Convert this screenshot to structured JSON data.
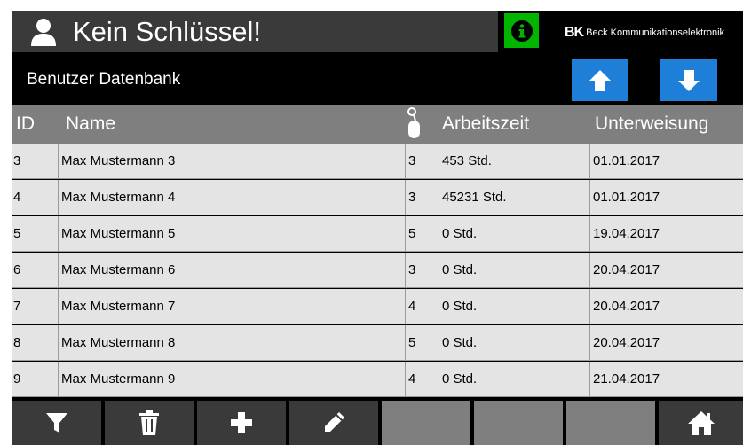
{
  "header": {
    "title": "Kein Schlüssel!",
    "info_icon": "info-circle-icon",
    "logo_mark": "BK",
    "logo_text": "Beck Kommunikationselektronik",
    "status_color": "#00b400"
  },
  "subheader": {
    "title": "Benutzer Datenbank",
    "up_icon": "arrow-up-icon",
    "down_icon": "arrow-down-icon",
    "accent": "#1e7fd8"
  },
  "table": {
    "columns": {
      "id": "ID",
      "name": "Name",
      "priority_icon": "mouse-key-icon",
      "time": "Arbeitszeit",
      "training": "Unterweisung"
    },
    "rows": [
      {
        "id": "3",
        "name": "Max Mustermann 3",
        "priority": "3",
        "time": "453 Std.",
        "training": "01.01.2017"
      },
      {
        "id": "4",
        "name": "Max Mustermann 4",
        "priority": "3",
        "time": "45231 Std.",
        "training": "01.01.2017"
      },
      {
        "id": "5",
        "name": "Max Mustermann 5",
        "priority": "5",
        "time": "0 Std.",
        "training": "19.04.2017"
      },
      {
        "id": "6",
        "name": "Max Mustermann 6",
        "priority": "3",
        "time": "0 Std.",
        "training": "20.04.2017"
      },
      {
        "id": "7",
        "name": "Max Mustermann 7",
        "priority": "4",
        "time": "0 Std.",
        "training": "20.04.2017"
      },
      {
        "id": "8",
        "name": "Max Mustermann 8",
        "priority": "5",
        "time": "0 Std.",
        "training": "20.04.2017"
      },
      {
        "id": "9",
        "name": "Max Mustermann 9",
        "priority": "4",
        "time": "0 Std.",
        "training": "21.04.2017"
      }
    ]
  },
  "toolbar": {
    "buttons": [
      "filter-icon",
      "trash-icon",
      "plus-icon",
      "pencil-icon",
      "",
      "",
      "",
      "home-icon"
    ]
  }
}
